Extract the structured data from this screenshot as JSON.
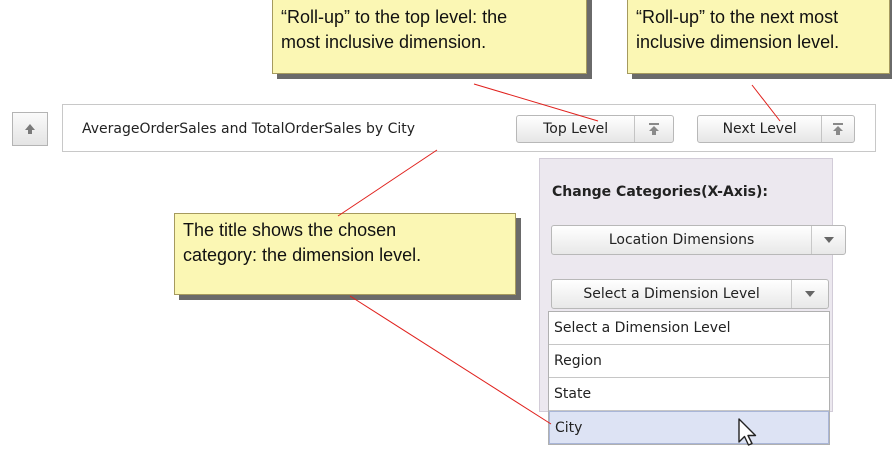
{
  "callouts": {
    "top_level": {
      "line1": "“Roll-up” to the top level: the",
      "line2": "most inclusive dimension."
    },
    "next_level": {
      "line1": "“Roll-up” to the next most",
      "line2": "inclusive dimension level."
    },
    "title": {
      "line1": "The title shows the chosen",
      "line2": "category: the dimension level."
    }
  },
  "toolbar": {
    "up_icon": "arrow-up-icon",
    "title": "AverageOrderSales and TotalOrderSales by City",
    "top_level_label": "Top Level",
    "next_level_label": "Next Level",
    "rollup_icon": "rollup-top-icon"
  },
  "categories_panel": {
    "title": "Change Categories(X-Axis):",
    "dimension_select": "Location Dimensions",
    "level_select": "Select a Dimension Level",
    "level_options": [
      "Select a Dimension Level",
      "Region",
      "State",
      "City"
    ],
    "highlighted_option": "City"
  },
  "colors": {
    "callout_bg": "#fbf7b4",
    "leader_line": "#e0201c",
    "panel_bg": "#ece8ef",
    "highlight": "#dde3f4"
  }
}
